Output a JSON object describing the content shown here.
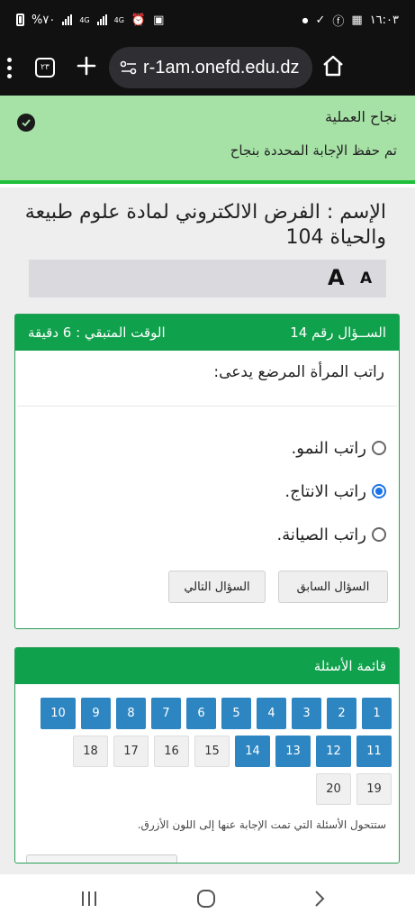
{
  "status_bar": {
    "battery": "%٧٠",
    "net1": "4G",
    "net2": "4G",
    "time": "١٦:٠٣"
  },
  "browser": {
    "tabs_count": "٢٣",
    "url": "r-1am.onefd.edu.dz"
  },
  "banner": {
    "title": "نجاح العملية",
    "message": "تم حفظ الإجابة المحددة بنجاح",
    "color": "#a6e2a6"
  },
  "page": {
    "title": "الإسم : الفرض الالكتروني لمادة علوم طبيعة والحياة 104",
    "font_large": "A",
    "font_small": "A"
  },
  "question": {
    "number_label": "الســؤال رقم 14",
    "time_left": "الوقت المتبقي : 6 دقيقة",
    "text": "راتب المرأة المرضع يدعى:",
    "options": [
      {
        "label": "راتب النمو.",
        "selected": false
      },
      {
        "label": "راتب الانتاج.",
        "selected": true
      },
      {
        "label": "راتب الصيانة.",
        "selected": false
      }
    ],
    "prev_label": "السؤال السابق",
    "next_label": "السؤال التالي"
  },
  "list": {
    "title": "قائمة الأسئلة",
    "answered": [
      "1",
      "2",
      "3",
      "4",
      "5",
      "6",
      "7",
      "8",
      "9",
      "10",
      "11",
      "12",
      "13",
      "14"
    ],
    "unanswered": [
      "15",
      "16",
      "17",
      "18",
      "19",
      "20"
    ],
    "note": "ستتحول الأسئلة التي تمت الإجابة عنها إلى اللون الأزرق."
  },
  "colors": {
    "accent_green": "#0fa14c",
    "answered_blue": "#2d86c2",
    "radio_blue": "#1a73e8"
  }
}
